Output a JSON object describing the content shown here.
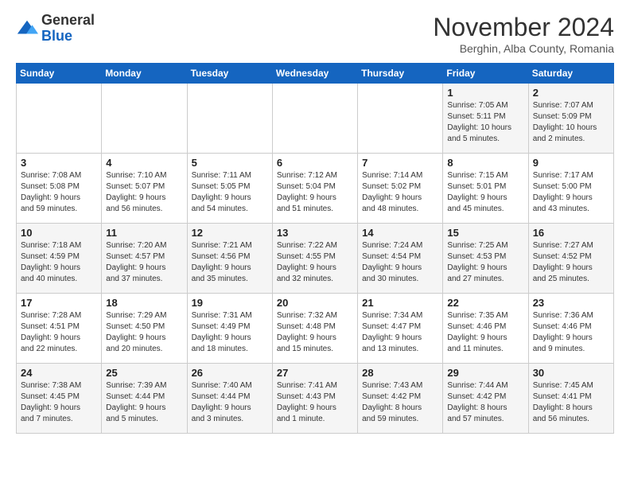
{
  "logo": {
    "general": "General",
    "blue": "Blue"
  },
  "header": {
    "month": "November 2024",
    "location": "Berghin, Alba County, Romania"
  },
  "weekdays": [
    "Sunday",
    "Monday",
    "Tuesday",
    "Wednesday",
    "Thursday",
    "Friday",
    "Saturday"
  ],
  "weeks": [
    [
      {
        "day": "",
        "info": ""
      },
      {
        "day": "",
        "info": ""
      },
      {
        "day": "",
        "info": ""
      },
      {
        "day": "",
        "info": ""
      },
      {
        "day": "",
        "info": ""
      },
      {
        "day": "1",
        "info": "Sunrise: 7:05 AM\nSunset: 5:11 PM\nDaylight: 10 hours\nand 5 minutes."
      },
      {
        "day": "2",
        "info": "Sunrise: 7:07 AM\nSunset: 5:09 PM\nDaylight: 10 hours\nand 2 minutes."
      }
    ],
    [
      {
        "day": "3",
        "info": "Sunrise: 7:08 AM\nSunset: 5:08 PM\nDaylight: 9 hours\nand 59 minutes."
      },
      {
        "day": "4",
        "info": "Sunrise: 7:10 AM\nSunset: 5:07 PM\nDaylight: 9 hours\nand 56 minutes."
      },
      {
        "day": "5",
        "info": "Sunrise: 7:11 AM\nSunset: 5:05 PM\nDaylight: 9 hours\nand 54 minutes."
      },
      {
        "day": "6",
        "info": "Sunrise: 7:12 AM\nSunset: 5:04 PM\nDaylight: 9 hours\nand 51 minutes."
      },
      {
        "day": "7",
        "info": "Sunrise: 7:14 AM\nSunset: 5:02 PM\nDaylight: 9 hours\nand 48 minutes."
      },
      {
        "day": "8",
        "info": "Sunrise: 7:15 AM\nSunset: 5:01 PM\nDaylight: 9 hours\nand 45 minutes."
      },
      {
        "day": "9",
        "info": "Sunrise: 7:17 AM\nSunset: 5:00 PM\nDaylight: 9 hours\nand 43 minutes."
      }
    ],
    [
      {
        "day": "10",
        "info": "Sunrise: 7:18 AM\nSunset: 4:59 PM\nDaylight: 9 hours\nand 40 minutes."
      },
      {
        "day": "11",
        "info": "Sunrise: 7:20 AM\nSunset: 4:57 PM\nDaylight: 9 hours\nand 37 minutes."
      },
      {
        "day": "12",
        "info": "Sunrise: 7:21 AM\nSunset: 4:56 PM\nDaylight: 9 hours\nand 35 minutes."
      },
      {
        "day": "13",
        "info": "Sunrise: 7:22 AM\nSunset: 4:55 PM\nDaylight: 9 hours\nand 32 minutes."
      },
      {
        "day": "14",
        "info": "Sunrise: 7:24 AM\nSunset: 4:54 PM\nDaylight: 9 hours\nand 30 minutes."
      },
      {
        "day": "15",
        "info": "Sunrise: 7:25 AM\nSunset: 4:53 PM\nDaylight: 9 hours\nand 27 minutes."
      },
      {
        "day": "16",
        "info": "Sunrise: 7:27 AM\nSunset: 4:52 PM\nDaylight: 9 hours\nand 25 minutes."
      }
    ],
    [
      {
        "day": "17",
        "info": "Sunrise: 7:28 AM\nSunset: 4:51 PM\nDaylight: 9 hours\nand 22 minutes."
      },
      {
        "day": "18",
        "info": "Sunrise: 7:29 AM\nSunset: 4:50 PM\nDaylight: 9 hours\nand 20 minutes."
      },
      {
        "day": "19",
        "info": "Sunrise: 7:31 AM\nSunset: 4:49 PM\nDaylight: 9 hours\nand 18 minutes."
      },
      {
        "day": "20",
        "info": "Sunrise: 7:32 AM\nSunset: 4:48 PM\nDaylight: 9 hours\nand 15 minutes."
      },
      {
        "day": "21",
        "info": "Sunrise: 7:34 AM\nSunset: 4:47 PM\nDaylight: 9 hours\nand 13 minutes."
      },
      {
        "day": "22",
        "info": "Sunrise: 7:35 AM\nSunset: 4:46 PM\nDaylight: 9 hours\nand 11 minutes."
      },
      {
        "day": "23",
        "info": "Sunrise: 7:36 AM\nSunset: 4:46 PM\nDaylight: 9 hours\nand 9 minutes."
      }
    ],
    [
      {
        "day": "24",
        "info": "Sunrise: 7:38 AM\nSunset: 4:45 PM\nDaylight: 9 hours\nand 7 minutes."
      },
      {
        "day": "25",
        "info": "Sunrise: 7:39 AM\nSunset: 4:44 PM\nDaylight: 9 hours\nand 5 minutes."
      },
      {
        "day": "26",
        "info": "Sunrise: 7:40 AM\nSunset: 4:44 PM\nDaylight: 9 hours\nand 3 minutes."
      },
      {
        "day": "27",
        "info": "Sunrise: 7:41 AM\nSunset: 4:43 PM\nDaylight: 9 hours\nand 1 minute."
      },
      {
        "day": "28",
        "info": "Sunrise: 7:43 AM\nSunset: 4:42 PM\nDaylight: 8 hours\nand 59 minutes."
      },
      {
        "day": "29",
        "info": "Sunrise: 7:44 AM\nSunset: 4:42 PM\nDaylight: 8 hours\nand 57 minutes."
      },
      {
        "day": "30",
        "info": "Sunrise: 7:45 AM\nSunset: 4:41 PM\nDaylight: 8 hours\nand 56 minutes."
      }
    ]
  ]
}
